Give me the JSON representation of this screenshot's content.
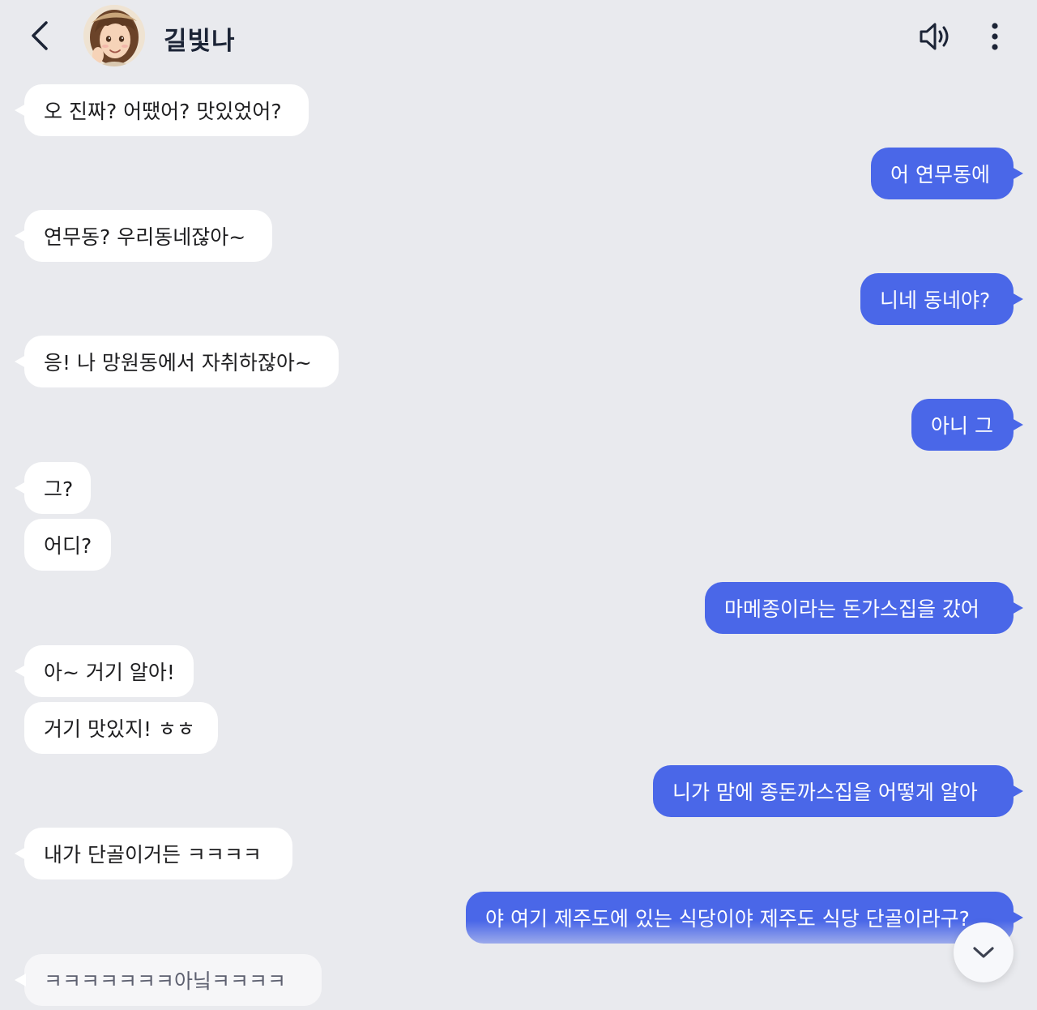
{
  "header": {
    "back_icon": "chevron-left-icon",
    "contact_name": "길빛나",
    "speaker_icon": "speaker-icon",
    "more_icon": "vertical-dots-icon"
  },
  "colors": {
    "background": "#e9eaee",
    "sent_bubble": "#4a67e8",
    "received_bubble": "#ffffff"
  },
  "messages": [
    {
      "sender": "them",
      "text": "오 진짜? 어땠어? 맛있었어?"
    },
    {
      "sender": "me",
      "text": "어 연무동에"
    },
    {
      "sender": "them",
      "text": "연무동? 우리동네잖아~"
    },
    {
      "sender": "me",
      "text": "니네 동네야?"
    },
    {
      "sender": "them",
      "text": "응! 나 망원동에서 자취하잖아~"
    },
    {
      "sender": "me",
      "text": "아니 그"
    },
    {
      "sender": "them",
      "text": "그?"
    },
    {
      "sender": "them",
      "text": "어디?"
    },
    {
      "sender": "me",
      "text": "마메종이라는 돈가스집을 갔어"
    },
    {
      "sender": "them",
      "text": "아~ 거기 알아!"
    },
    {
      "sender": "them",
      "text": "거기 맛있지! ㅎㅎ"
    },
    {
      "sender": "me",
      "text": "니가 맘에 종돈까스집을 어떻게 알아"
    },
    {
      "sender": "them",
      "text": "내가 단골이거든 ㅋㅋㅋㅋ"
    },
    {
      "sender": "me",
      "text": "야 여기 제주도에 있는 식당이야 제주도 식당 단골이라구?"
    },
    {
      "sender": "them",
      "text": "ㅋㅋㅋㅋㅋㅋㅋ아닠ㅋㅋㅋㅋ"
    }
  ],
  "scroll_down_icon": "chevron-down-icon"
}
